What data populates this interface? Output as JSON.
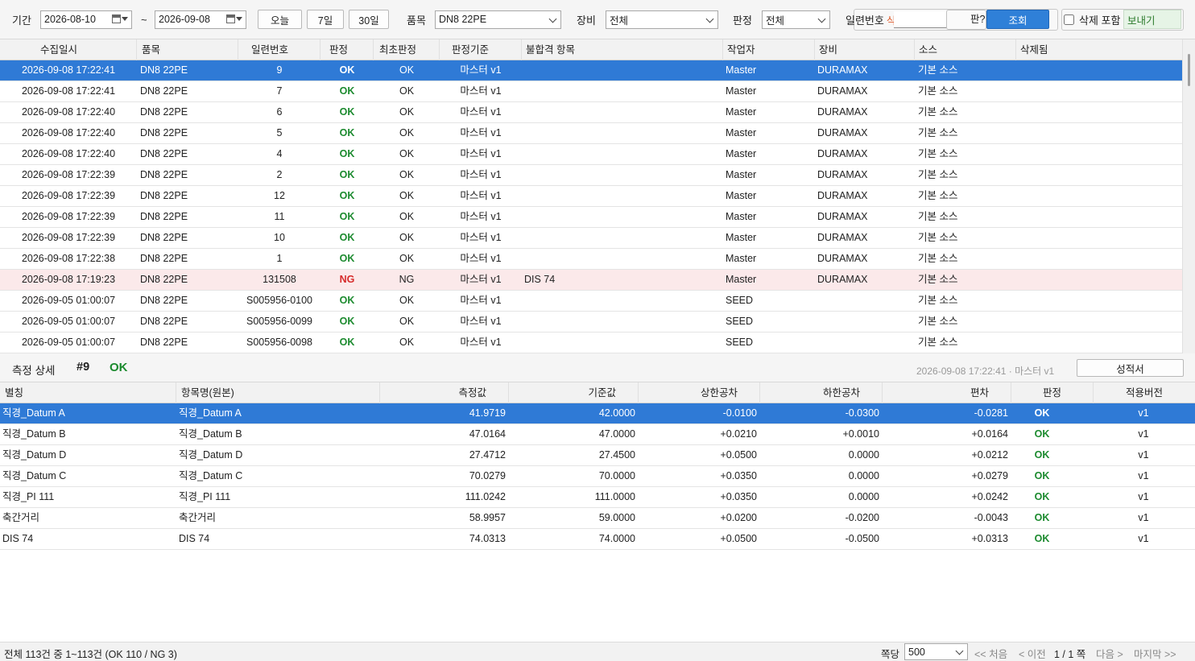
{
  "toolbar": {
    "period_label": "기간",
    "date_from": "2026-08-10",
    "tilde": "~",
    "date_to": "2026-09-08",
    "today_btn": "오늘",
    "days7_btn": "7일",
    "days30_btn": "30일",
    "product_label": "품목",
    "product_value": "DN8 22PE",
    "equipment_label": "장비",
    "equipment_value": "전체",
    "judge_label": "판정",
    "judge_value": "전체",
    "serial_label": "일련번호",
    "serial_partial_char": "식",
    "hidden_btn_partial": "판?",
    "search_btn": "조회",
    "include_deleted_label": "삭제 포함",
    "export_btn": "보내기"
  },
  "records": {
    "columns": [
      "수집일시",
      "품목",
      "일련번호",
      "판정",
      "최초판정",
      "판정기준",
      "불합격 항목",
      "작업자",
      "장비",
      "소스",
      "삭제됨"
    ],
    "rows": [
      {
        "time": "2026-09-08 17:22:41",
        "product": "DN8 22PE",
        "serial": "9",
        "judge": "OK",
        "first": "OK",
        "basis": "마스터 v1",
        "fail": "",
        "worker": "Master",
        "equip": "DURAMAX",
        "source": "기본 소스",
        "deleted": "",
        "state": "selected"
      },
      {
        "time": "2026-09-08 17:22:41",
        "product": "DN8 22PE",
        "serial": "7",
        "judge": "OK",
        "first": "OK",
        "basis": "마스터 v1",
        "fail": "",
        "worker": "Master",
        "equip": "DURAMAX",
        "source": "기본 소스",
        "deleted": "",
        "state": ""
      },
      {
        "time": "2026-09-08 17:22:40",
        "product": "DN8 22PE",
        "serial": "6",
        "judge": "OK",
        "first": "OK",
        "basis": "마스터 v1",
        "fail": "",
        "worker": "Master",
        "equip": "DURAMAX",
        "source": "기본 소스",
        "deleted": "",
        "state": ""
      },
      {
        "time": "2026-09-08 17:22:40",
        "product": "DN8 22PE",
        "serial": "5",
        "judge": "OK",
        "first": "OK",
        "basis": "마스터 v1",
        "fail": "",
        "worker": "Master",
        "equip": "DURAMAX",
        "source": "기본 소스",
        "deleted": "",
        "state": ""
      },
      {
        "time": "2026-09-08 17:22:40",
        "product": "DN8 22PE",
        "serial": "4",
        "judge": "OK",
        "first": "OK",
        "basis": "마스터 v1",
        "fail": "",
        "worker": "Master",
        "equip": "DURAMAX",
        "source": "기본 소스",
        "deleted": "",
        "state": ""
      },
      {
        "time": "2026-09-08 17:22:39",
        "product": "DN8 22PE",
        "serial": "2",
        "judge": "OK",
        "first": "OK",
        "basis": "마스터 v1",
        "fail": "",
        "worker": "Master",
        "equip": "DURAMAX",
        "source": "기본 소스",
        "deleted": "",
        "state": ""
      },
      {
        "time": "2026-09-08 17:22:39",
        "product": "DN8 22PE",
        "serial": "12",
        "judge": "OK",
        "first": "OK",
        "basis": "마스터 v1",
        "fail": "",
        "worker": "Master",
        "equip": "DURAMAX",
        "source": "기본 소스",
        "deleted": "",
        "state": ""
      },
      {
        "time": "2026-09-08 17:22:39",
        "product": "DN8 22PE",
        "serial": "11",
        "judge": "OK",
        "first": "OK",
        "basis": "마스터 v1",
        "fail": "",
        "worker": "Master",
        "equip": "DURAMAX",
        "source": "기본 소스",
        "deleted": "",
        "state": ""
      },
      {
        "time": "2026-09-08 17:22:39",
        "product": "DN8 22PE",
        "serial": "10",
        "judge": "OK",
        "first": "OK",
        "basis": "마스터 v1",
        "fail": "",
        "worker": "Master",
        "equip": "DURAMAX",
        "source": "기본 소스",
        "deleted": "",
        "state": ""
      },
      {
        "time": "2026-09-08 17:22:38",
        "product": "DN8 22PE",
        "serial": "1",
        "judge": "OK",
        "first": "OK",
        "basis": "마스터 v1",
        "fail": "",
        "worker": "Master",
        "equip": "DURAMAX",
        "source": "기본 소스",
        "deleted": "",
        "state": ""
      },
      {
        "time": "2026-09-08 17:19:23",
        "product": "DN8 22PE",
        "serial": "131508",
        "judge": "NG",
        "first": "NG",
        "basis": "마스터 v1",
        "fail": "DIS 74",
        "worker": "Master",
        "equip": "DURAMAX",
        "source": "기본 소스",
        "deleted": "",
        "state": "ng"
      },
      {
        "time": "2026-09-05 01:00:07",
        "product": "DN8 22PE",
        "serial": "S005956-0100",
        "judge": "OK",
        "first": "OK",
        "basis": "마스터 v1",
        "fail": "",
        "worker": "SEED",
        "equip": "",
        "source": "기본 소스",
        "deleted": "",
        "state": ""
      },
      {
        "time": "2026-09-05 01:00:07",
        "product": "DN8 22PE",
        "serial": "S005956-0099",
        "judge": "OK",
        "first": "OK",
        "basis": "마스터 v1",
        "fail": "",
        "worker": "SEED",
        "equip": "",
        "source": "기본 소스",
        "deleted": "",
        "state": ""
      },
      {
        "time": "2026-09-05 01:00:07",
        "product": "DN8 22PE",
        "serial": "S005956-0098",
        "judge": "OK",
        "first": "OK",
        "basis": "마스터 v1",
        "fail": "",
        "worker": "SEED",
        "equip": "",
        "source": "기본 소스",
        "deleted": "",
        "state": ""
      }
    ]
  },
  "detail": {
    "title": "측정 상세",
    "number": "#9",
    "result": "OK",
    "meta": "2026-09-08 17:22:41 · 마스터 v1",
    "report_btn": "성적서",
    "columns": [
      "별칭",
      "항목명(원본)",
      "측정값",
      "기준값",
      "상한공차",
      "하한공차",
      "편차",
      "판정",
      "적용버전"
    ],
    "rows": [
      {
        "alias": "직경_Datum A",
        "name": "직경_Datum A",
        "measured": "41.9719",
        "nominal": "42.0000",
        "upper": "-0.0100",
        "lower": "-0.0300",
        "dev": "-0.0281",
        "judge": "OK",
        "ver": "v1",
        "state": "selected"
      },
      {
        "alias": "직경_Datum B",
        "name": "직경_Datum B",
        "measured": "47.0164",
        "nominal": "47.0000",
        "upper": "+0.0210",
        "lower": "+0.0010",
        "dev": "+0.0164",
        "judge": "OK",
        "ver": "v1",
        "state": ""
      },
      {
        "alias": "직경_Datum D",
        "name": "직경_Datum D",
        "measured": "27.4712",
        "nominal": "27.4500",
        "upper": "+0.0500",
        "lower": "0.0000",
        "dev": "+0.0212",
        "judge": "OK",
        "ver": "v1",
        "state": ""
      },
      {
        "alias": "직경_Datum C",
        "name": "직경_Datum C",
        "measured": "70.0279",
        "nominal": "70.0000",
        "upper": "+0.0350",
        "lower": "0.0000",
        "dev": "+0.0279",
        "judge": "OK",
        "ver": "v1",
        "state": ""
      },
      {
        "alias": "직경_PI 111",
        "name": "직경_PI 111",
        "measured": "111.0242",
        "nominal": "111.0000",
        "upper": "+0.0350",
        "lower": "0.0000",
        "dev": "+0.0242",
        "judge": "OK",
        "ver": "v1",
        "state": ""
      },
      {
        "alias": "축간거리",
        "name": "축간거리",
        "measured": "58.9957",
        "nominal": "59.0000",
        "upper": "+0.0200",
        "lower": "-0.0200",
        "dev": "-0.0043",
        "judge": "OK",
        "ver": "v1",
        "state": ""
      },
      {
        "alias": "DIS 74",
        "name": "DIS 74",
        "measured": "74.0313",
        "nominal": "74.0000",
        "upper": "+0.0500",
        "lower": "-0.0500",
        "dev": "+0.0313",
        "judge": "OK",
        "ver": "v1",
        "state": ""
      }
    ]
  },
  "status": {
    "summary": "전체 113건 중 1~113건 (OK 110 / NG 3)",
    "page_size_label": "쪽당",
    "page_size": "500",
    "first": "<< 처음",
    "prev": "< 이전",
    "page_info": "1 / 1 쪽",
    "next": "다음 >",
    "last": "마지막 >>"
  },
  "colors": {
    "selection": "#2f7ad6",
    "ok": "#1b8a2e",
    "ng": "#d62b2b",
    "ng_row": "#fbe9ea",
    "search_btn": "#2f80d8"
  }
}
